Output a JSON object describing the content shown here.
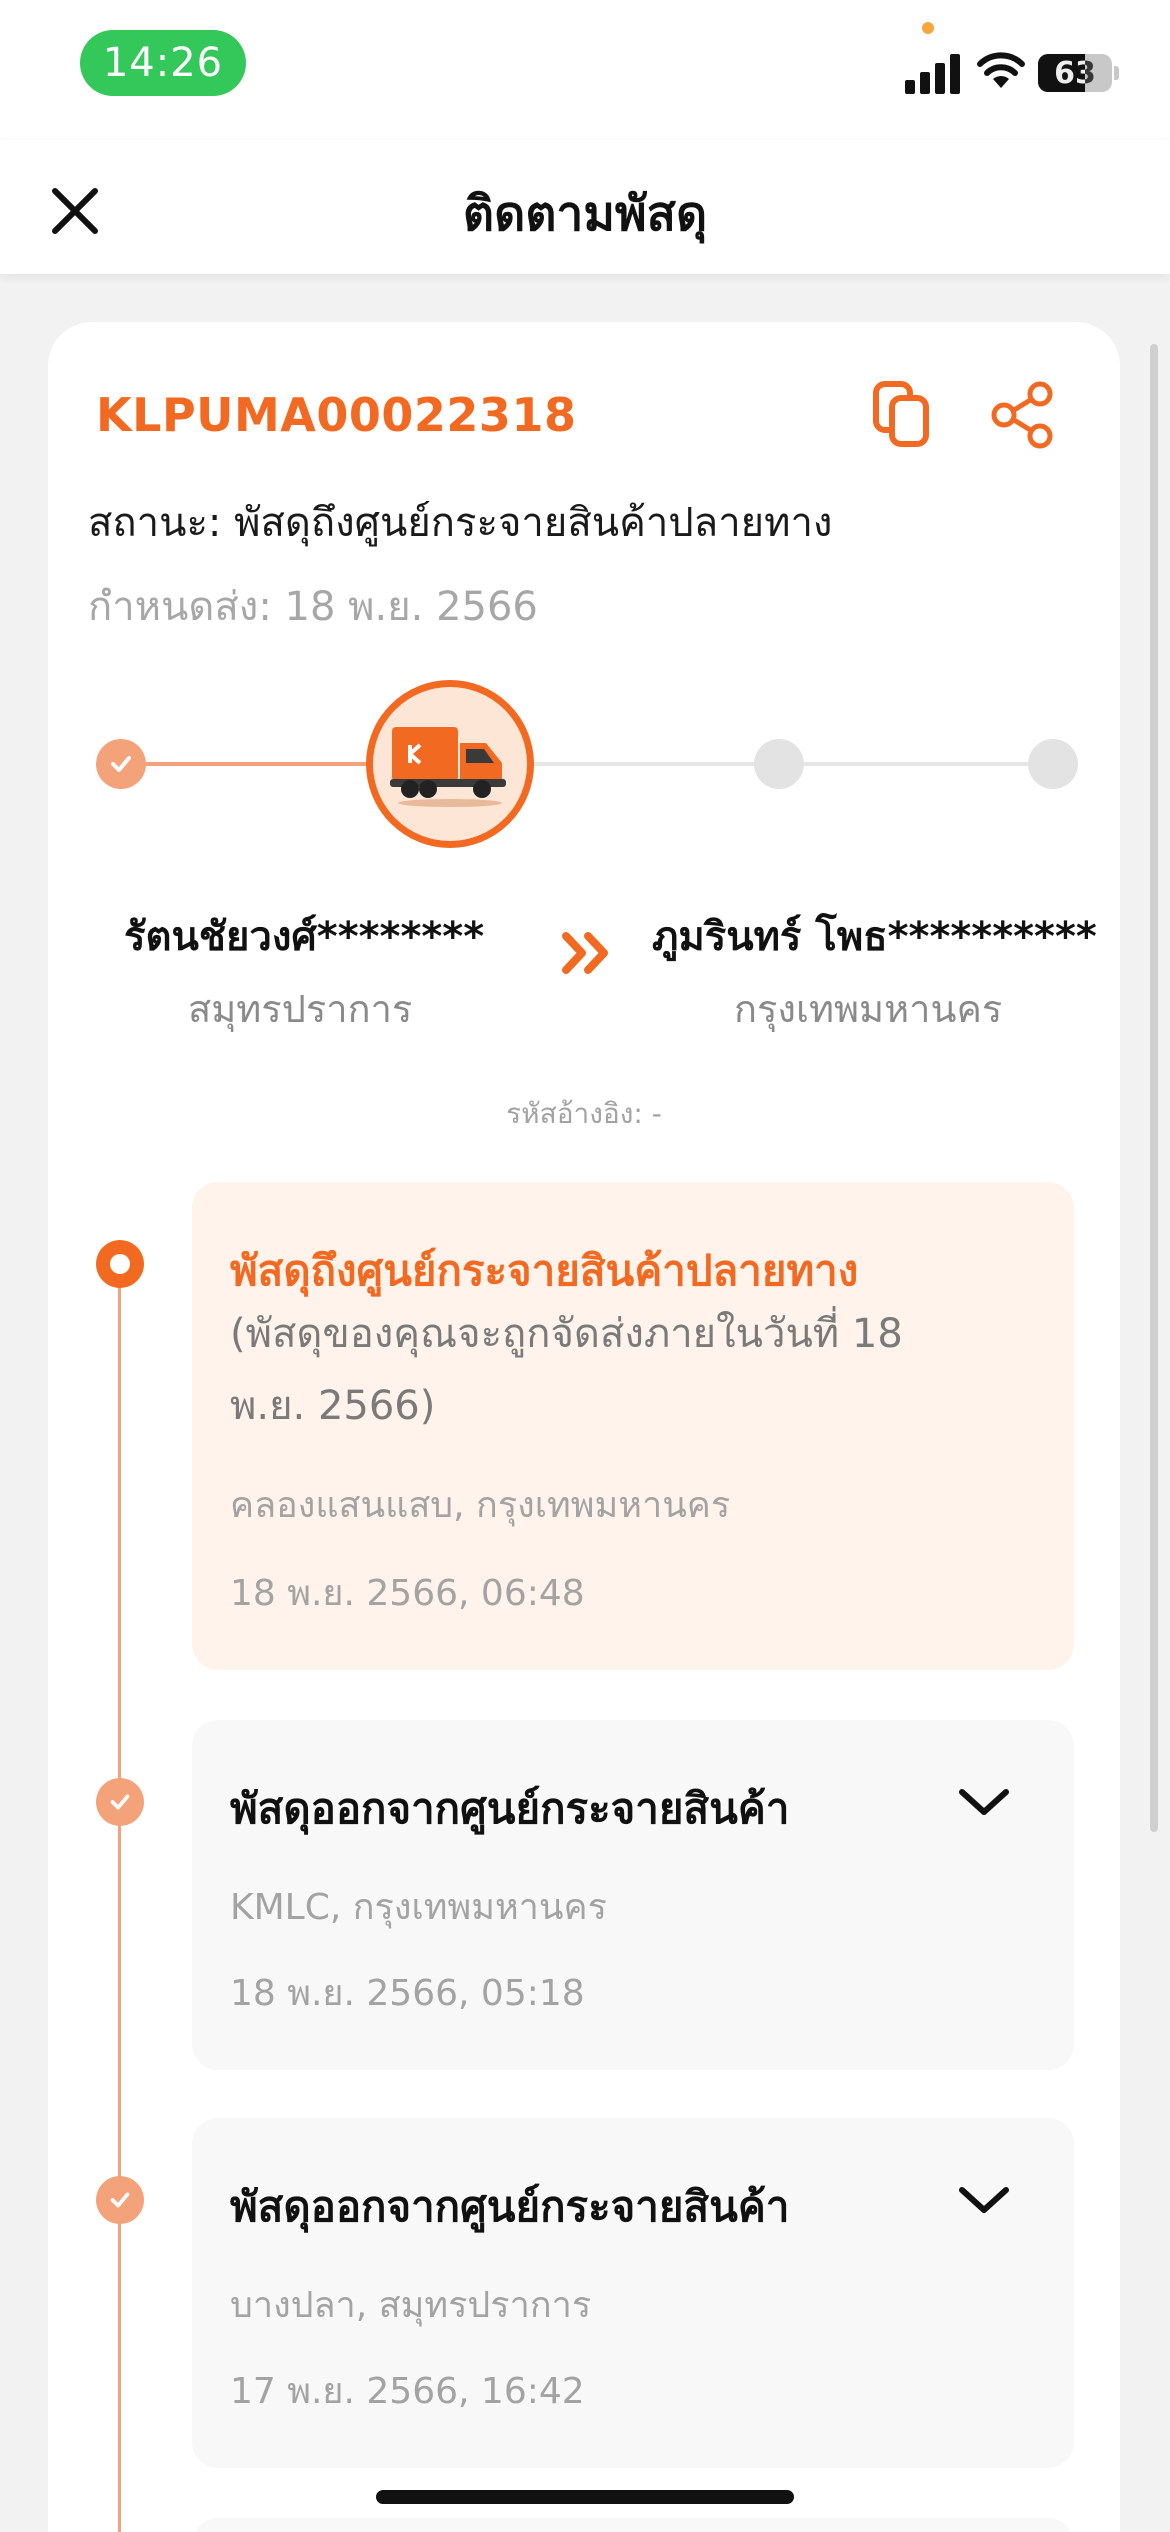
{
  "status_bar": {
    "time": "14:26",
    "battery_percent": 63,
    "battery_label": "63"
  },
  "header": {
    "title": "ติดตามพัสดุ",
    "close_icon": "close-icon"
  },
  "shipment": {
    "tracking_number": "KLPUMA00022318",
    "status_text": "สถานะ: พัสดุถึงศูนย์กระจายสินค้าปลายทาง",
    "due_text": "กำหนดส่ง: 18 พ.ย. 2566",
    "progress_step": 2,
    "progress_steps_total": 4,
    "sender": {
      "name": "รัตนชัยวงศ์********",
      "province": "สมุทรปราการ"
    },
    "receiver": {
      "name": "ภูมรินทร์  โพธ**********",
      "province": "กรุงเทพมหานคร"
    },
    "reference": "รหัสอ้างอิง: -"
  },
  "timeline": [
    {
      "title": "พัสดุถึงศูนย์กระจายสินค้าปลายทาง",
      "note": "(พัสดุของคุณจะถูกจัดส่งภายในวันที่ 18 พ.ย. 2566)",
      "location": "คลองแสนแสบ, กรุงเทพมหานคร",
      "time": "18 พ.ย. 2566, 06:48",
      "active": true
    },
    {
      "title": "พัสดุออกจากศูนย์กระจายสินค้า",
      "location": "KMLC, กรุงเทพมหานคร",
      "time": "18 พ.ย. 2566, 05:18",
      "active": false
    },
    {
      "title": "พัสดุออกจากศูนย์กระจายสินค้า",
      "location": "บางปลา, สมุทรปราการ",
      "time": "17 พ.ย. 2566, 16:42",
      "active": false
    }
  ],
  "colors": {
    "accent": "#f26a21",
    "accent_light": "#f4a27a",
    "active_card_bg": "#fff3ec",
    "status_pill": "#34c759"
  }
}
